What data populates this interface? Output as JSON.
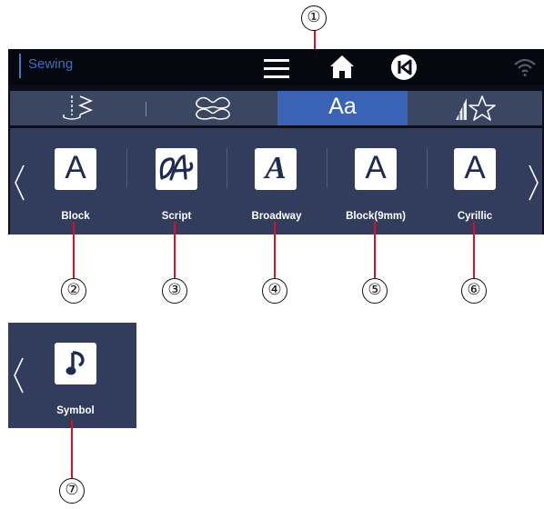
{
  "topbar": {
    "title": "Sewing"
  },
  "tabs": [
    {
      "name": "stitch"
    },
    {
      "name": "decorative"
    },
    {
      "name": "letters",
      "label": "Aa",
      "active": true
    },
    {
      "name": "favorites"
    }
  ],
  "fonts": [
    {
      "glyph": "A",
      "label": "Block"
    },
    {
      "glyph": "A",
      "label": "Script"
    },
    {
      "glyph": "A",
      "label": "Broadway"
    },
    {
      "glyph": "A",
      "label": "Block(9mm)"
    },
    {
      "glyph": "A",
      "label": "Cyrillic"
    }
  ],
  "symbol_panel": {
    "label": "Symbol"
  },
  "callouts": [
    "①",
    "②",
    "③",
    "④",
    "⑤",
    "⑥",
    "⑦"
  ],
  "colors": {
    "accent": "#3a63b5",
    "panel": "#323c5d",
    "callout_line": "#d8102a"
  }
}
